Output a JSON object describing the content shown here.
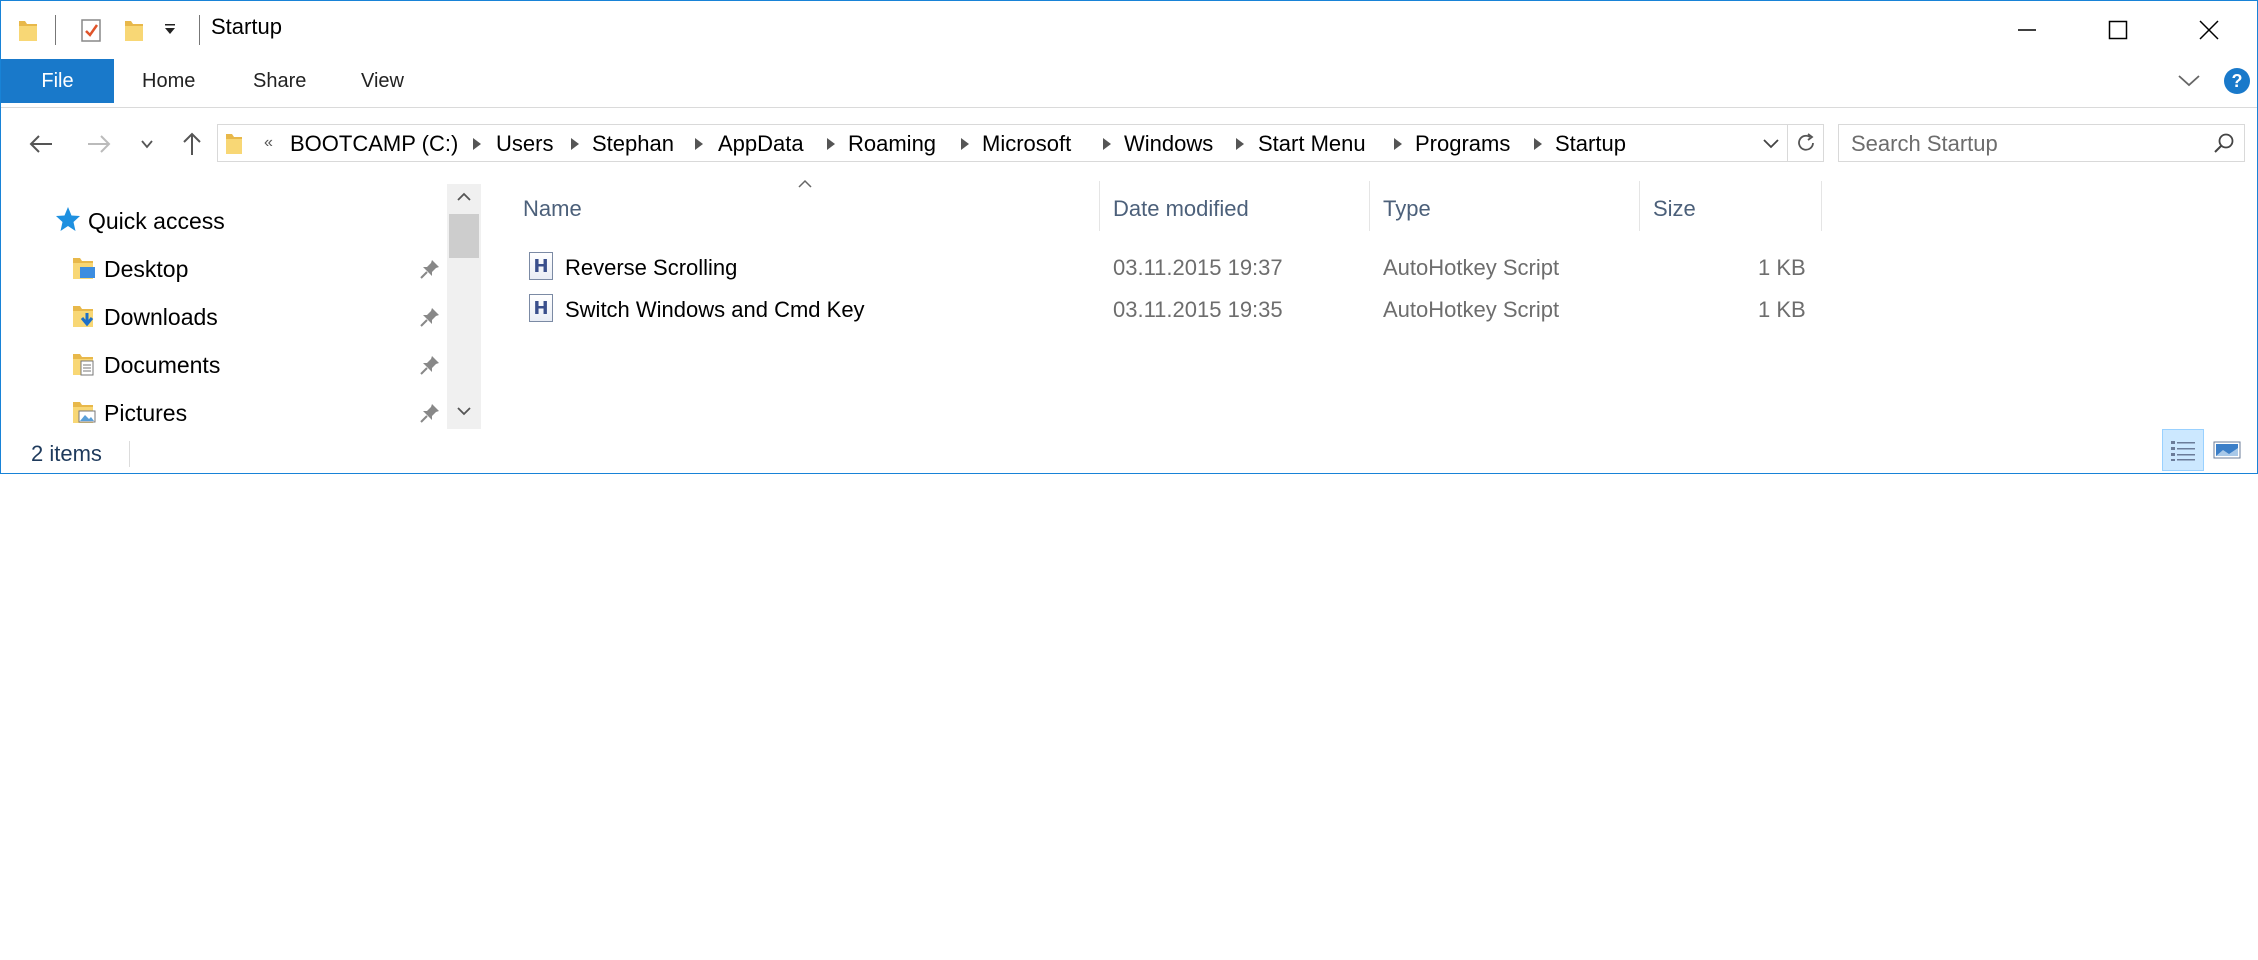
{
  "window": {
    "title": "Startup"
  },
  "ribbon": {
    "file_label": "File",
    "tabs": [
      "Home",
      "Share",
      "View"
    ]
  },
  "address": {
    "overflow_glyph": "«",
    "crumbs": [
      "BOOTCAMP (C:)",
      "Users",
      "Stephan",
      "AppData",
      "Roaming",
      "Microsoft",
      "Windows",
      "Start Menu",
      "Programs",
      "Startup"
    ]
  },
  "search": {
    "placeholder": "Search Startup"
  },
  "nav": {
    "quick_access": "Quick access",
    "items": [
      "Desktop",
      "Downloads",
      "Documents",
      "Pictures"
    ]
  },
  "columns": {
    "name": "Name",
    "date": "Date modified",
    "type": "Type",
    "size": "Size"
  },
  "files": [
    {
      "name": "Reverse Scrolling",
      "date": "03.11.2015 19:37",
      "type": "AutoHotkey Script",
      "size": "1 KB"
    },
    {
      "name": "Switch Windows and Cmd Key",
      "date": "03.11.2015 19:35",
      "type": "AutoHotkey Script",
      "size": "1 KB"
    }
  ],
  "status": {
    "item_count": "2 items"
  },
  "icons": {
    "file_type_glyph": "H",
    "accent": "#1979ca",
    "folder_yellow": "#f8d775",
    "star_blue": "#1e90e0"
  }
}
